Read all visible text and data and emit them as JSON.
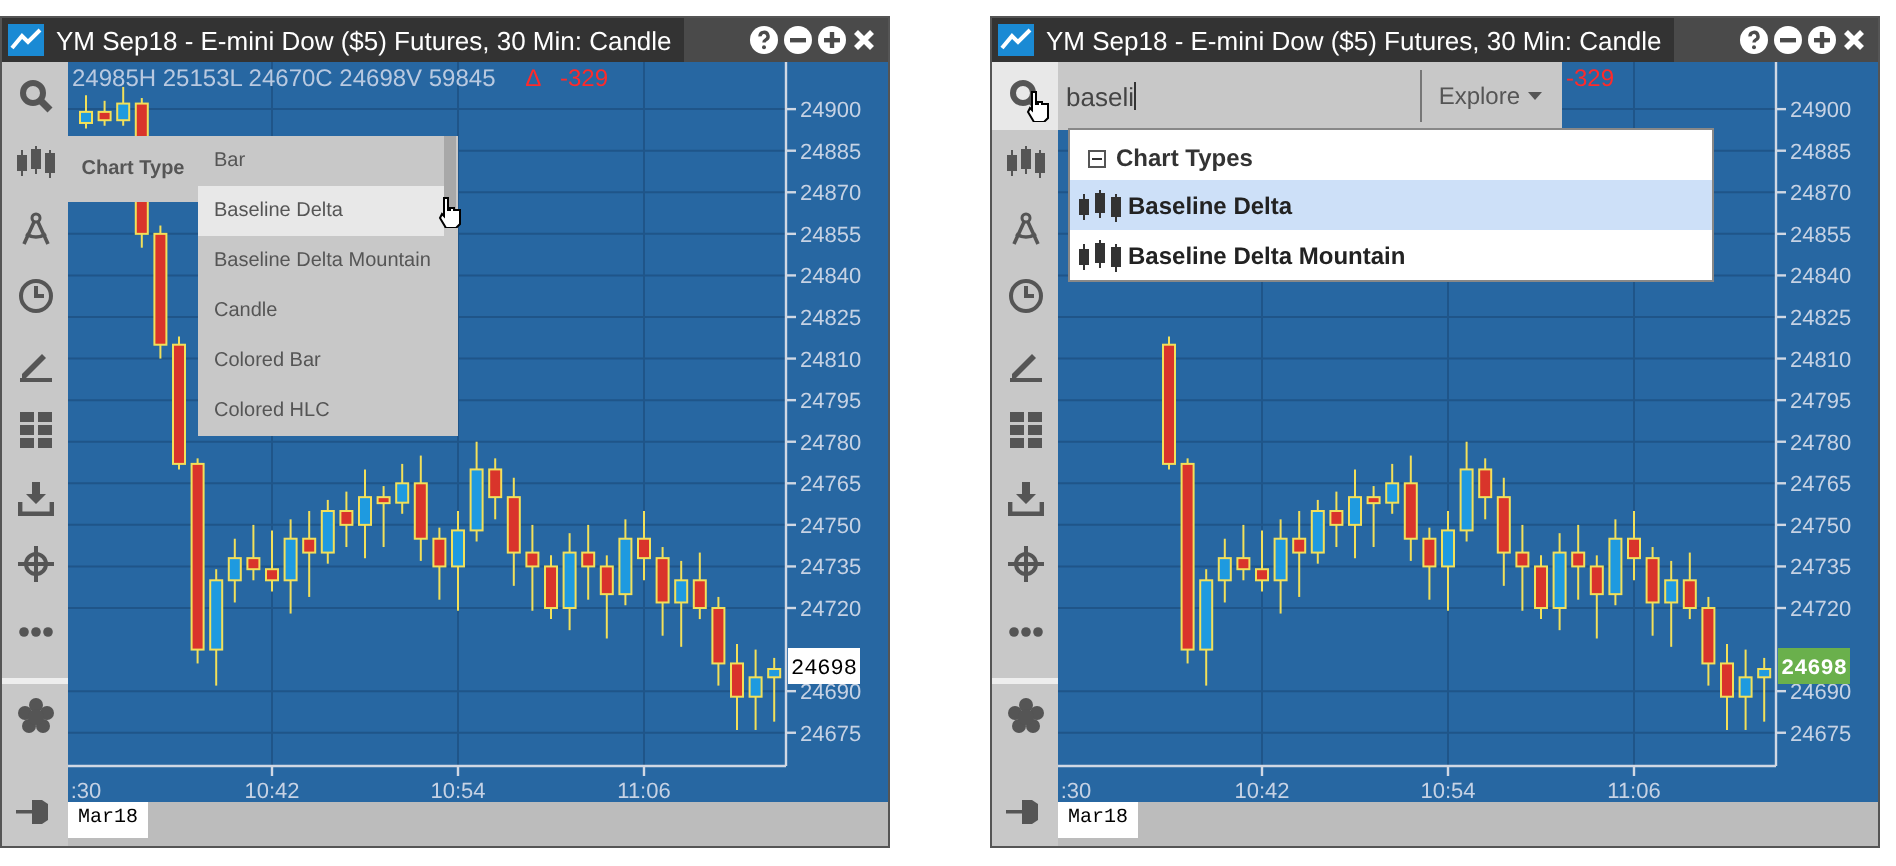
{
  "panels": [
    {
      "title": "YM Sep18 - E-mini Dow ($5) Futures, 30 Min: Candle",
      "legend": {
        "values": "24985H  25153L  24670C  24698V  59845",
        "delta_mark": "∆",
        "change": "-329"
      },
      "tools": [
        {
          "kind": "search",
          "active": false
        },
        {
          "kind": "candles",
          "active": false
        },
        {
          "kind": "compass",
          "active": false
        },
        {
          "kind": "clock",
          "active": false
        },
        {
          "kind": "pencil",
          "active": false
        },
        {
          "kind": "grid",
          "active": false
        },
        {
          "kind": "download",
          "active": false
        },
        {
          "kind": "crosshair",
          "active": false
        },
        {
          "kind": "more",
          "active": false
        }
      ],
      "bottom_tools": [
        {
          "kind": "flower"
        },
        {
          "kind": "pin"
        }
      ],
      "chart_type_menu": {
        "label": "Chart Type",
        "items": [
          {
            "label": "Bar",
            "hovered": false
          },
          {
            "label": "Baseline Delta",
            "hovered": true
          },
          {
            "label": "Baseline Delta Mountain",
            "hovered": false
          },
          {
            "label": "Candle",
            "hovered": false
          },
          {
            "label": "Colored Bar",
            "hovered": false
          },
          {
            "label": "Colored HLC",
            "hovered": false
          }
        ]
      },
      "chart_data": {
        "type": "candlestick",
        "grid": true,
        "ylim": [
          24663,
          24917
        ],
        "yticks": [
          24900,
          24885,
          24870,
          24855,
          24840,
          24825,
          24810,
          24795,
          24780,
          24765,
          24750,
          24735,
          24720,
          24690,
          24675
        ],
        "categories": [
          ":30",
          null,
          null,
          null,
          null,
          null,
          null,
          null,
          null,
          null,
          "10:42",
          null,
          null,
          null,
          null,
          null,
          null,
          null,
          null,
          null,
          "10:54",
          null,
          null,
          null,
          null,
          null,
          null,
          null,
          null,
          null,
          "11:06",
          null,
          null,
          null,
          null,
          null,
          null,
          null
        ],
        "ohlc": [
          [
            24895,
            24905,
            24893,
            24899
          ],
          [
            24899,
            24903,
            24894,
            24896
          ],
          [
            24896,
            24908,
            24894,
            24902
          ],
          [
            24902,
            24904,
            24850,
            24855
          ],
          [
            24855,
            24858,
            24810,
            24815
          ],
          [
            24815,
            24818,
            24770,
            24772
          ],
          [
            24772,
            24774,
            24700,
            24705
          ],
          [
            24705,
            24734,
            24692,
            24730
          ],
          [
            24730,
            24745,
            24722,
            24738
          ],
          [
            24738,
            24750,
            24730,
            24734
          ],
          [
            24734,
            24748,
            24726,
            24730
          ],
          [
            24730,
            24752,
            24718,
            24745
          ],
          [
            24745,
            24755,
            24724,
            24740
          ],
          [
            24740,
            24759,
            24736,
            24755
          ],
          [
            24755,
            24762,
            24742,
            24750
          ],
          [
            24750,
            24770,
            24738,
            24760
          ],
          [
            24760,
            24764,
            24742,
            24758
          ],
          [
            24758,
            24772,
            24754,
            24765
          ],
          [
            24765,
            24775,
            24737,
            24745
          ],
          [
            24745,
            24749,
            24723,
            24735
          ],
          [
            24735,
            24755,
            24719,
            24748
          ],
          [
            24748,
            24780,
            24744,
            24770
          ],
          [
            24770,
            24774,
            24752,
            24760
          ],
          [
            24760,
            24767,
            24728,
            24740
          ],
          [
            24740,
            24750,
            24719,
            24735
          ],
          [
            24735,
            24739,
            24716,
            24720
          ],
          [
            24720,
            24747,
            24712,
            24740
          ],
          [
            24740,
            24750,
            24723,
            24735
          ],
          [
            24735,
            24739,
            24709,
            24725
          ],
          [
            24725,
            24752,
            24721,
            24745
          ],
          [
            24745,
            24755,
            24730,
            24738
          ],
          [
            24738,
            24742,
            24710,
            24722
          ],
          [
            24722,
            24737,
            24706,
            24730
          ],
          [
            24730,
            24740,
            24716,
            24720
          ],
          [
            24720,
            24724,
            24692,
            24700
          ],
          [
            24700,
            24707,
            24676,
            24688
          ],
          [
            24688,
            24705,
            24676,
            24695
          ],
          [
            24695,
            24702,
            24679,
            24698
          ]
        ]
      },
      "price_tag": {
        "text": "24698",
        "highlighted": false
      },
      "date_label": "Mar18"
    },
    {
      "title": "YM Sep18 - E-mini Dow ($5) Futures, 30 Min: Candle",
      "legend": {
        "change": "-329"
      },
      "tools": [
        {
          "kind": "search",
          "active": true
        },
        {
          "kind": "candles",
          "active": false
        },
        {
          "kind": "compass",
          "active": false
        },
        {
          "kind": "clock",
          "active": false
        },
        {
          "kind": "pencil",
          "active": false
        },
        {
          "kind": "grid",
          "active": false
        },
        {
          "kind": "download",
          "active": false
        },
        {
          "kind": "crosshair",
          "active": false
        },
        {
          "kind": "more",
          "active": false
        }
      ],
      "bottom_tools": [
        {
          "kind": "flower"
        },
        {
          "kind": "pin"
        }
      ],
      "search": {
        "value": "baseli",
        "button": "Explore"
      },
      "results": {
        "group": "Chart Types",
        "expanded": true,
        "items": [
          {
            "label": "Baseline Delta",
            "selected": true
          },
          {
            "label": "Baseline Delta Mountain",
            "selected": false
          }
        ]
      },
      "chart_data": {
        "type": "candlestick",
        "grid": true,
        "ylim": [
          24663,
          24917
        ],
        "yticks": [
          24900,
          24885,
          24870,
          24855,
          24840,
          24825,
          24810,
          24795,
          24780,
          24765,
          24750,
          24735,
          24720,
          24690,
          24675
        ],
        "categories": [
          ":30",
          null,
          null,
          null,
          null,
          null,
          null,
          null,
          null,
          null,
          "10:42",
          null,
          null,
          null,
          null,
          null,
          null,
          null,
          null,
          null,
          "10:54",
          null,
          null,
          null,
          null,
          null,
          null,
          null,
          null,
          null,
          "11:06",
          null,
          null,
          null,
          null,
          null,
          null,
          null
        ],
        "ohlc": [
          null,
          null,
          null,
          null,
          null,
          [
            24815,
            24818,
            24770,
            24772
          ],
          [
            24772,
            24774,
            24700,
            24705
          ],
          [
            24705,
            24734,
            24692,
            24730
          ],
          [
            24730,
            24745,
            24722,
            24738
          ],
          [
            24738,
            24750,
            24730,
            24734
          ],
          [
            24734,
            24748,
            24726,
            24730
          ],
          [
            24730,
            24752,
            24718,
            24745
          ],
          [
            24745,
            24755,
            24724,
            24740
          ],
          [
            24740,
            24759,
            24736,
            24755
          ],
          [
            24755,
            24762,
            24742,
            24750
          ],
          [
            24750,
            24770,
            24738,
            24760
          ],
          [
            24760,
            24764,
            24742,
            24758
          ],
          [
            24758,
            24772,
            24754,
            24765
          ],
          [
            24765,
            24775,
            24737,
            24745
          ],
          [
            24745,
            24749,
            24723,
            24735
          ],
          [
            24735,
            24755,
            24719,
            24748
          ],
          [
            24748,
            24780,
            24744,
            24770
          ],
          [
            24770,
            24774,
            24752,
            24760
          ],
          [
            24760,
            24767,
            24728,
            24740
          ],
          [
            24740,
            24750,
            24719,
            24735
          ],
          [
            24735,
            24739,
            24716,
            24720
          ],
          [
            24720,
            24747,
            24712,
            24740
          ],
          [
            24740,
            24750,
            24723,
            24735
          ],
          [
            24735,
            24739,
            24709,
            24725
          ],
          [
            24725,
            24752,
            24721,
            24745
          ],
          [
            24745,
            24755,
            24730,
            24738
          ],
          [
            24738,
            24742,
            24710,
            24722
          ],
          [
            24722,
            24737,
            24706,
            24730
          ],
          [
            24730,
            24740,
            24716,
            24720
          ],
          [
            24720,
            24724,
            24692,
            24700
          ],
          [
            24700,
            24707,
            24676,
            24688
          ],
          [
            24688,
            24705,
            24676,
            24695
          ],
          [
            24695,
            24702,
            24679,
            24698
          ]
        ]
      },
      "price_tag": {
        "text": "24698",
        "highlighted": true
      },
      "date_label": "Mar18"
    }
  ]
}
